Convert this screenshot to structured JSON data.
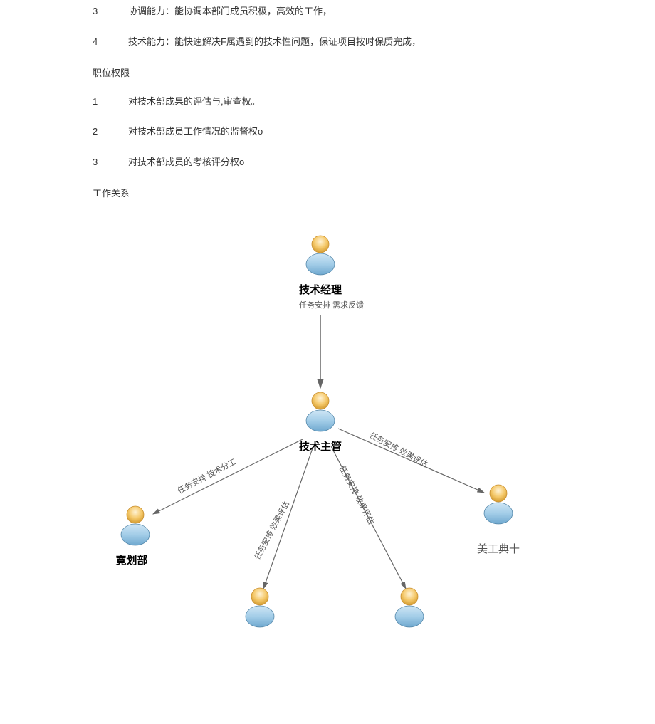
{
  "items_top": [
    {
      "num": "3",
      "text": "协调能力：能协调本部门成员积极，高效的工作，"
    },
    {
      "num": "4",
      "text": "技术能力：能快速解决F属遇到的技术性问题，保证项目按时保质完成，"
    }
  ],
  "section_auth": "职位权限",
  "items_auth": [
    {
      "num": "1",
      "text": "对技术部成果的评估与,审查权。"
    },
    {
      "num": "2",
      "text": "对技术部成员工作情况的监督权o"
    },
    {
      "num": "3",
      "text": "对技术部成员的考核评分权o"
    }
  ],
  "section_rel": "工作关系",
  "diagram": {
    "top": {
      "label": "技术经理",
      "sub": "任务安排   需求反馈"
    },
    "mid": {
      "label": "技术主管"
    },
    "left": {
      "label": "寛划部"
    },
    "right": {
      "label": "美工典十"
    },
    "edge_left": "任务安排  技术分工",
    "edge_right": "任务安排   效果评估",
    "edge_bl": "任务安排  效果评估",
    "edge_br": "任务安排  效果评估"
  }
}
